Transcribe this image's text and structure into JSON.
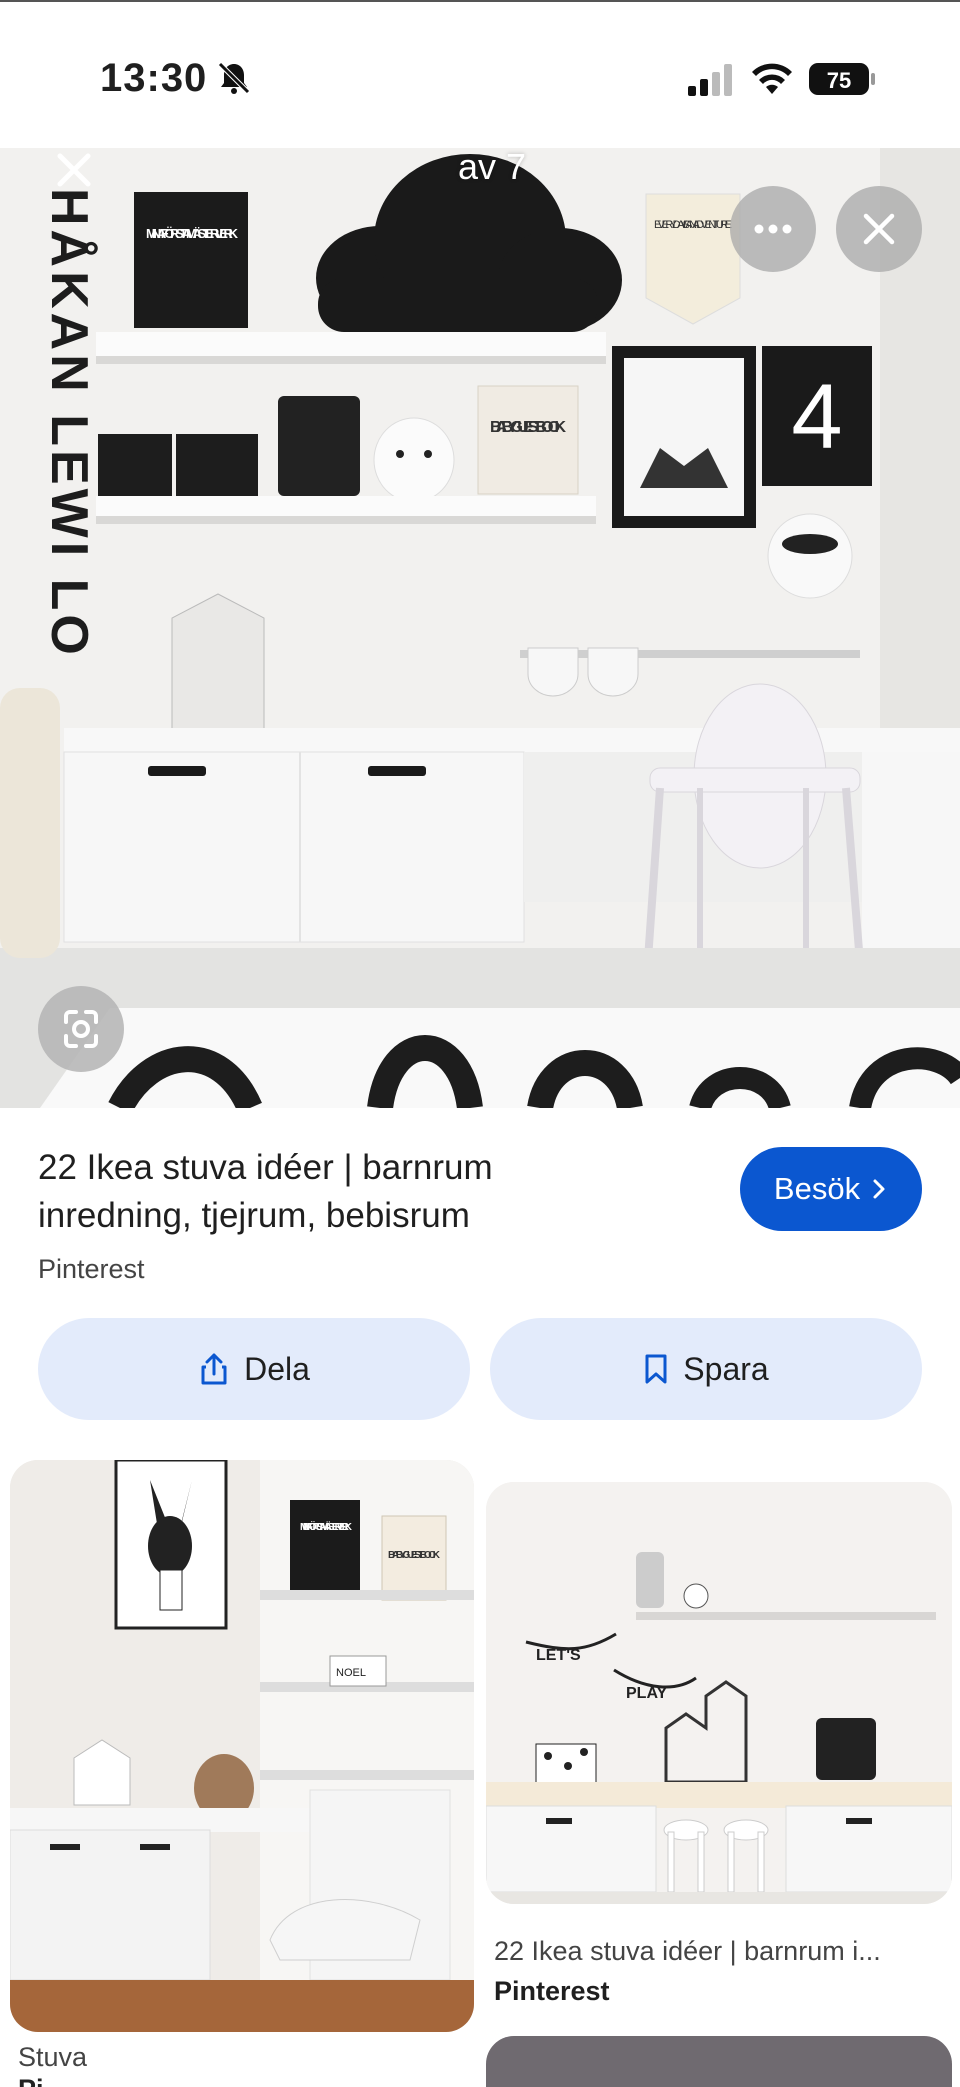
{
  "status_bar": {
    "time": "13:30",
    "battery_level": "75",
    "icons": [
      "bell-slash-icon",
      "cellular-signal-icon",
      "wifi-icon",
      "battery-icon"
    ]
  },
  "viewer": {
    "counter": "av 7",
    "more_icon": "more-horizontal-icon",
    "close_icon": "close-icon",
    "lens_icon": "lens-search-icon",
    "hero_text": {
      "wall_letters": "HÅKAN LEWI LO",
      "frame_1": "MINA FÖRSTA MÄSTER-VERK",
      "box": "BABY GUEST BOOK",
      "pennant": "EVERY DAY IS AN ADVENTURE",
      "number": "4"
    }
  },
  "result": {
    "title": "22 Ikea stuva idéer | barnrum inredning, tjejrum, bebisrum",
    "source": "Pinterest",
    "visit_label": "Besök",
    "share_label": "Dela",
    "save_label": "Spara"
  },
  "grid": {
    "left_card": {
      "source": "Stuva",
      "source_2": "Pi...",
      "image_text": [
        "MINA FÖRSTA MÄSTER-VERK",
        "BABY GUEST BOOK",
        "NOEL"
      ]
    },
    "right_card": {
      "title": "22 Ikea stuva idéer | barnrum i...",
      "source": "Pinterest",
      "image_text": [
        "LET'S",
        "PLAY"
      ]
    }
  },
  "colors": {
    "accent": "#0b57d0",
    "pill_bg": "#e3ebfb"
  }
}
